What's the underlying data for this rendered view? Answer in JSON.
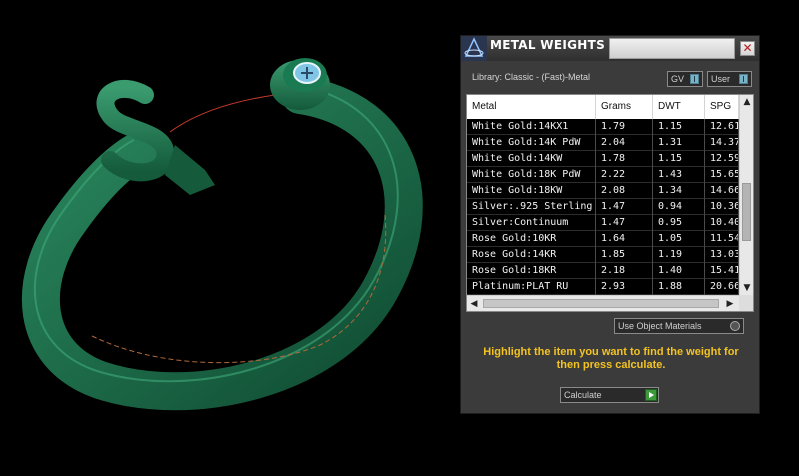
{
  "panel": {
    "title": "METAL WEIGHTS",
    "close_glyph": "✕",
    "library_label": "Library: Classic - (Fast)-Metal",
    "toggles": [
      {
        "label": "GV"
      },
      {
        "label": "User"
      }
    ]
  },
  "table": {
    "columns": [
      "Metal",
      "Grams",
      "DWT",
      "SPG"
    ],
    "rows": [
      {
        "metal": "White Gold:14KX1",
        "grams": "1.79",
        "dwt": "1.15",
        "spg": "12.61"
      },
      {
        "metal": "White Gold:14K PdW",
        "grams": "2.04",
        "dwt": "1.31",
        "spg": "14.37"
      },
      {
        "metal": "White Gold:14KW",
        "grams": "1.78",
        "dwt": "1.15",
        "spg": "12.59"
      },
      {
        "metal": "White Gold:18K PdW",
        "grams": "2.22",
        "dwt": "1.43",
        "spg": "15.65"
      },
      {
        "metal": "White Gold:18KW",
        "grams": "2.08",
        "dwt": "1.34",
        "spg": "14.66"
      },
      {
        "metal": "Silver:.925 Sterling",
        "grams": "1.47",
        "dwt": "0.94",
        "spg": "10.36"
      },
      {
        "metal": "Silver:Continuum",
        "grams": "1.47",
        "dwt": "0.95",
        "spg": "10.40"
      },
      {
        "metal": "Rose Gold:10KR",
        "grams": "1.64",
        "dwt": "1.05",
        "spg": "11.54"
      },
      {
        "metal": "Rose Gold:14KR",
        "grams": "1.85",
        "dwt": "1.19",
        "spg": "13.03"
      },
      {
        "metal": "Rose Gold:18KR",
        "grams": "2.18",
        "dwt": "1.40",
        "spg": "15.41"
      },
      {
        "metal": "Platinum:PLAT RU",
        "grams": "2.93",
        "dwt": "1.88",
        "spg": "20.66"
      }
    ]
  },
  "options": {
    "materials_dropdown": "Use Object Materials"
  },
  "hint": "Highlight the item you want to find the weight for then press calculate.",
  "calculate_label": "Calculate",
  "colors": {
    "ring": "#1f6e4c",
    "accent_text": "#f3c322",
    "panel_bg": "#3b3b3b"
  }
}
